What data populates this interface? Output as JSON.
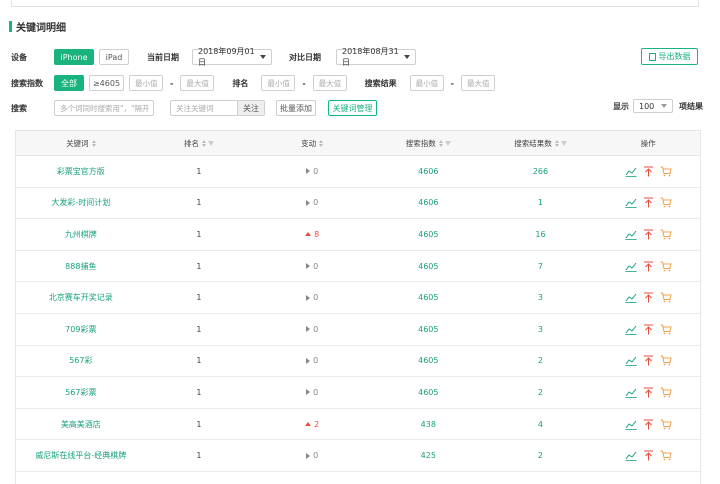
{
  "section": {
    "title": "关键词明细"
  },
  "filters": {
    "device_label": "设备",
    "devices": [
      "iPhone",
      "iPad"
    ],
    "current_date_label": "当前日期",
    "current_date": "2018年09月01日",
    "compare_date_label": "对比日期",
    "compare_date": "2018年08月31日",
    "export_label": "导出数据",
    "search_index_label": "搜索指数",
    "search_index_all": "全部",
    "search_index_ge": "≥4605",
    "min_placeholder": "最小值",
    "max_placeholder": "最大值",
    "dash": "-",
    "rank_label": "排名",
    "results_label": "搜索结果",
    "search_label": "搜索",
    "search_placeholder": "多个词同时搜索用\"，\"隔开",
    "follow_placeholder": "关注关键词",
    "follow_btn": "关注",
    "batch_add": "批量添加",
    "manage": "关键词管理",
    "show_label": "显示",
    "show_value": "100",
    "show_suffix": "项结果"
  },
  "table": {
    "headers": [
      "关键词",
      "排名",
      "变动",
      "搜索指数",
      "搜索结果数",
      "操作"
    ],
    "rows": [
      {
        "keyword": "彩票宝官方版",
        "rank": "1",
        "change": "0",
        "dir": "flat",
        "index": "4606",
        "results": "266"
      },
      {
        "keyword": "大发彩-时间计划",
        "rank": "1",
        "change": "0",
        "dir": "flat",
        "index": "4606",
        "results": "1"
      },
      {
        "keyword": "九州棋牌",
        "rank": "1",
        "change": "8",
        "dir": "up",
        "index": "4605",
        "results": "16"
      },
      {
        "keyword": "888捕鱼",
        "rank": "1",
        "change": "0",
        "dir": "flat",
        "index": "4605",
        "results": "7"
      },
      {
        "keyword": "北京赛车开奖记录",
        "rank": "1",
        "change": "0",
        "dir": "flat",
        "index": "4605",
        "results": "3"
      },
      {
        "keyword": "709彩票",
        "rank": "1",
        "change": "0",
        "dir": "flat",
        "index": "4605",
        "results": "3"
      },
      {
        "keyword": "567彩",
        "rank": "1",
        "change": "0",
        "dir": "flat",
        "index": "4605",
        "results": "2"
      },
      {
        "keyword": "567彩票",
        "rank": "1",
        "change": "0",
        "dir": "flat",
        "index": "4605",
        "results": "2"
      },
      {
        "keyword": "美高美酒店",
        "rank": "1",
        "change": "2",
        "dir": "up",
        "index": "438",
        "results": "4"
      },
      {
        "keyword": "威尼斯在线平台-经典棋牌",
        "rank": "1",
        "change": "0",
        "dir": "flat",
        "index": "425",
        "results": "2"
      },
      {
        "keyword": "",
        "rank": "",
        "change": "",
        "dir": "flat",
        "index": "",
        "results": ""
      }
    ]
  },
  "colors": {
    "accent": "#19b37d",
    "up": "#e74c3c",
    "icon_trend": "#19a07c",
    "icon_top": "#e74c3c",
    "icon_cart": "#f0a050"
  },
  "icons": [
    "trend-chart-icon",
    "pin-top-icon",
    "cart-icon"
  ]
}
